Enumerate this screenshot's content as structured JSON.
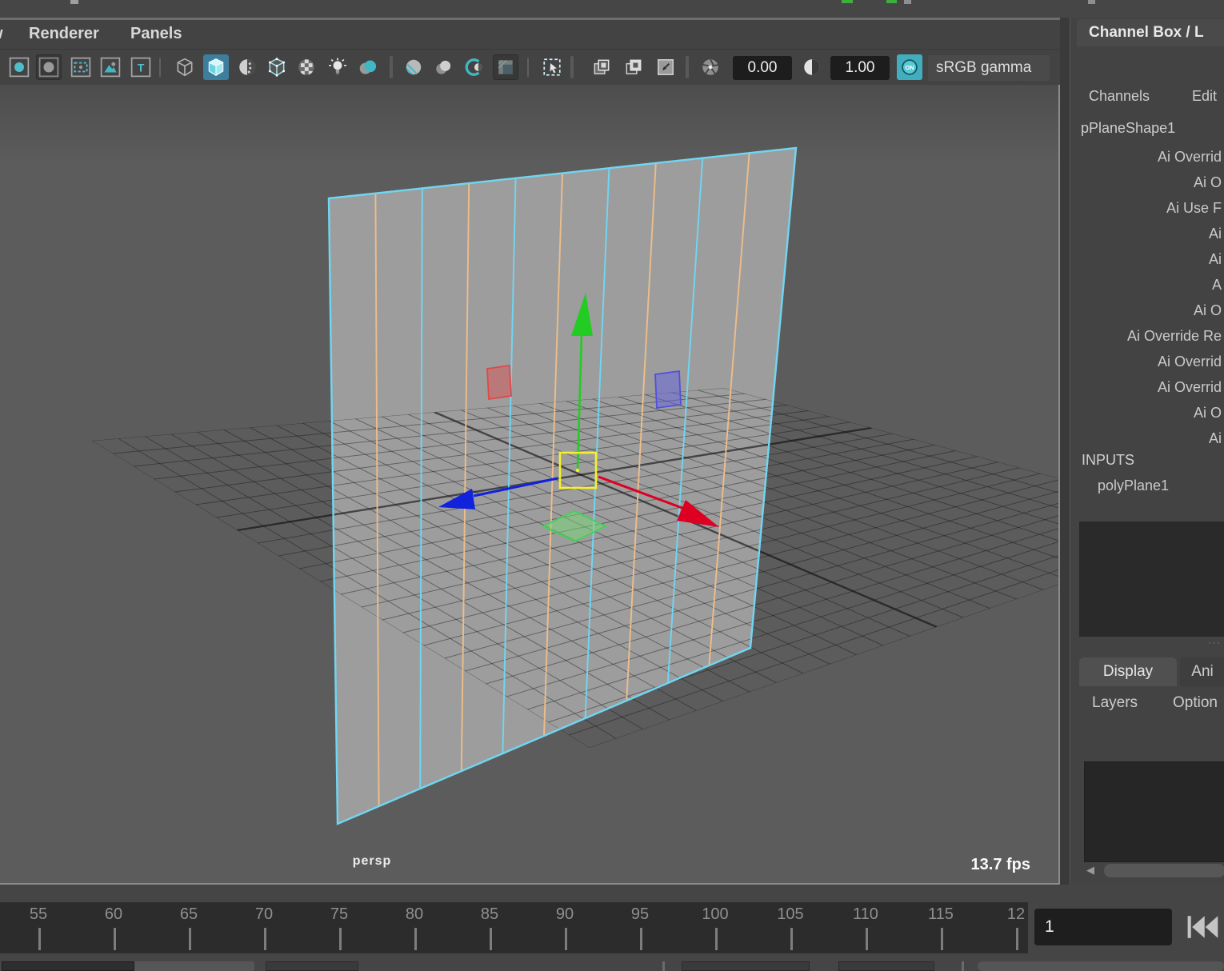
{
  "panel_menu": {
    "partial_item": "w",
    "items": [
      "Renderer",
      "Panels"
    ]
  },
  "toolbar": {
    "exposure_value": "0.00",
    "gamma_value": "1.00",
    "on_label": "ON",
    "view_transform": "sRGB gamma",
    "icons": [
      "select-camera",
      "lock-camera",
      "resolution-gate",
      "image-plane",
      "field-chart",
      "wireframe",
      "smooth-shade-all",
      "wireframe-on-shaded",
      "textured",
      "use-default-material",
      "lighting",
      "shadows",
      "ambient-occlusion",
      "motion-blur",
      "lookdev",
      "background",
      "isolate-select",
      "duplicate-view",
      "duplicate-view-alt",
      "snapshot",
      "exposure",
      "contrast"
    ]
  },
  "viewport": {
    "camera_label": "persp",
    "fps_label": "13.7 fps"
  },
  "channel_box": {
    "title": "Channel Box / L",
    "menu": [
      "Channels",
      "Edit"
    ],
    "object_name": "pPlaneShape1",
    "attributes": [
      "Ai Overrid",
      "Ai O",
      "Ai Use F",
      "Ai",
      "Ai",
      "A",
      "Ai O",
      "Ai Override Re",
      "Ai Overrid",
      "Ai Overrid",
      "Ai O",
      "Ai"
    ],
    "inputs_label": "INPUTS",
    "input_node": "polyPlane1",
    "grip": "···"
  },
  "layer_editor": {
    "tabs": [
      "Display",
      "Ani"
    ],
    "menu": [
      "Layers",
      "Option"
    ]
  },
  "timeline": {
    "ticks": [
      "55",
      "60",
      "65",
      "70",
      "75",
      "80",
      "85",
      "90",
      "95",
      "100",
      "105",
      "110",
      "115",
      "12"
    ],
    "current_frame": "1"
  },
  "colors": {
    "accent_teal": "#4fbecb",
    "active_tool_bg": "#3c7e9c",
    "axis_x": "#dd0022",
    "axis_y": "#22cc22",
    "axis_z": "#1122dd",
    "selection_yellow": "#f6ef2d",
    "wireframe_cyan": "#70d6f2",
    "wireframe_orange": "#edbd8a"
  }
}
